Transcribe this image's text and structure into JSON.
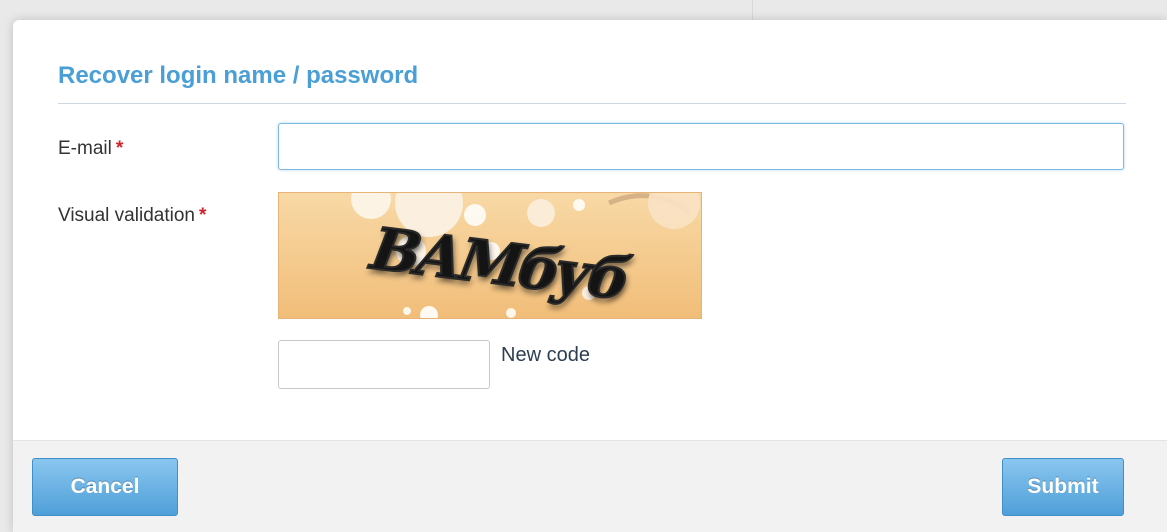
{
  "dialog": {
    "title": "Recover login name / password"
  },
  "form": {
    "email": {
      "label": "E-mail",
      "required_marker": "*",
      "value": "",
      "placeholder": ""
    },
    "visual_validation": {
      "label": "Visual validation",
      "required_marker": "*",
      "captcha_text": "BAMбуб",
      "code_value": "",
      "code_placeholder": "",
      "new_code_label": "New code"
    }
  },
  "footer": {
    "cancel_label": "Cancel",
    "submit_label": "Submit"
  },
  "colors": {
    "title": "#4a9fd6",
    "required": "#d0232b",
    "button_top": "#8ac6ef",
    "button_bottom": "#4f9fd9",
    "captcha_background": "#f5c98a"
  }
}
